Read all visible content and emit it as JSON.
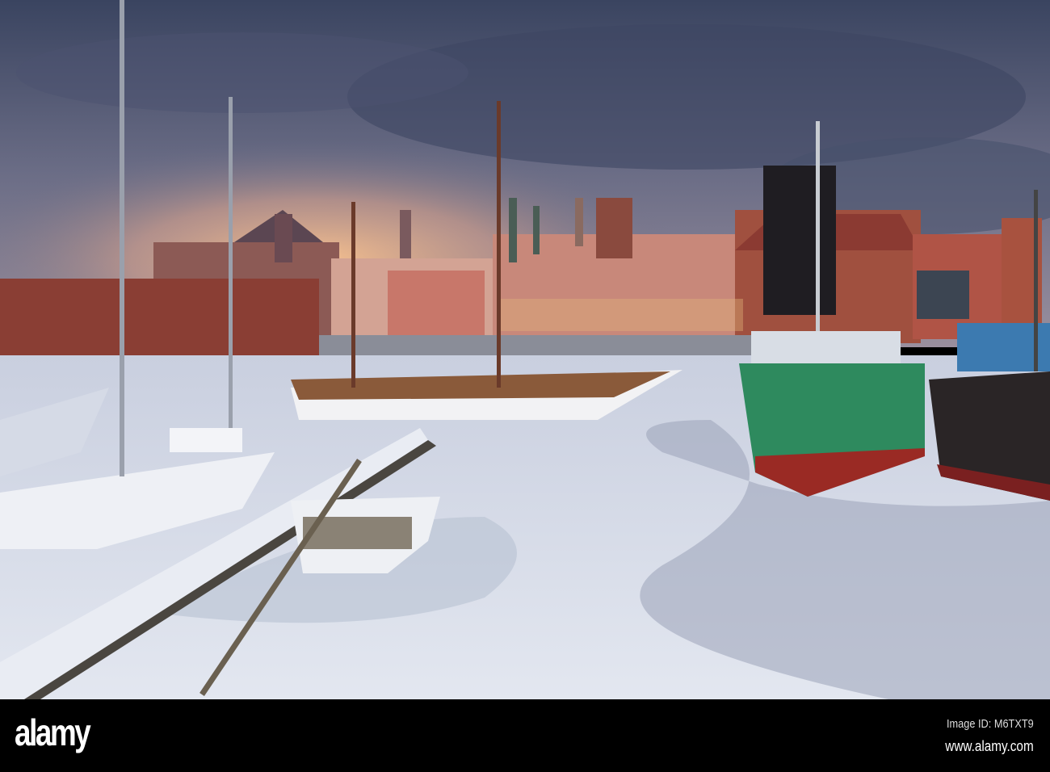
{
  "watermark": {
    "logo": "alamy",
    "image_id": "Image ID: M6TXT9",
    "url": "www.alamy.com"
  },
  "colors": {
    "sky_top": "#3b4560",
    "sky_glow": "#f0b488",
    "ice": "#dde2ee",
    "ship_green": "#2e8a5e",
    "brick": "#a0503f"
  }
}
